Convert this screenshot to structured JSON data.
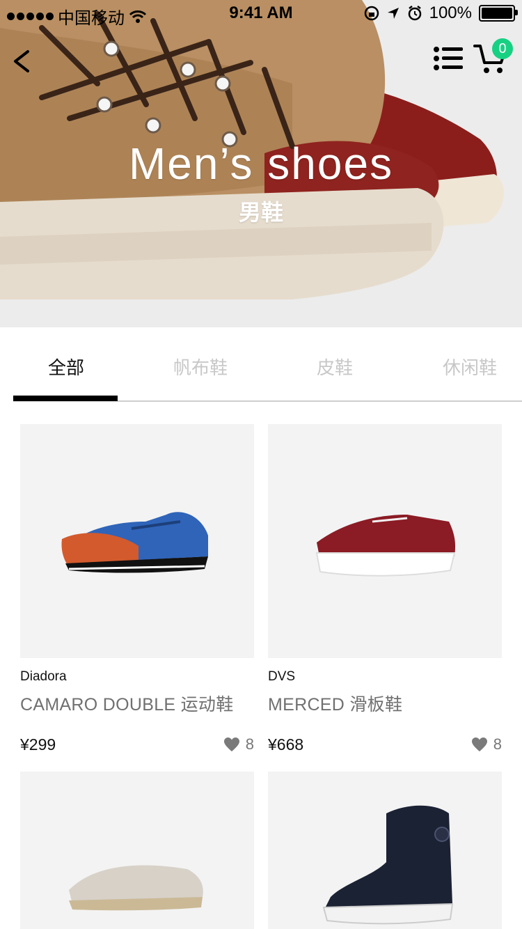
{
  "status_bar": {
    "carrier": "中国移动",
    "time": "9:41 AM",
    "battery": "100%",
    "battery_level": 1.0
  },
  "hero": {
    "title": "Men’s shoes",
    "subtitle": "男鞋"
  },
  "nav": {
    "back_icon": "chevron-left-icon",
    "menu_icon": "list-icon",
    "cart_icon": "cart-icon",
    "cart_count": "0"
  },
  "tabs": [
    {
      "label": "全部",
      "active": true
    },
    {
      "label": "帆布鞋",
      "active": false
    },
    {
      "label": "皮鞋",
      "active": false
    },
    {
      "label": "休闲鞋",
      "active": false
    }
  ],
  "products": [
    {
      "brand": "Diadora",
      "name": "CAMARO DOUBLE 运动鞋",
      "price": "¥299",
      "likes": "8"
    },
    {
      "brand": "DVS",
      "name": "MERCED 滑板鞋",
      "price": "¥668",
      "likes": "8"
    },
    {
      "brand": "",
      "name": "",
      "price": "",
      "likes": ""
    },
    {
      "brand": "",
      "name": "",
      "price": "",
      "likes": ""
    }
  ],
  "colors": {
    "accent": "#17d183",
    "tab_active": "#111111",
    "tab_inactive": "#c8c8c8"
  }
}
